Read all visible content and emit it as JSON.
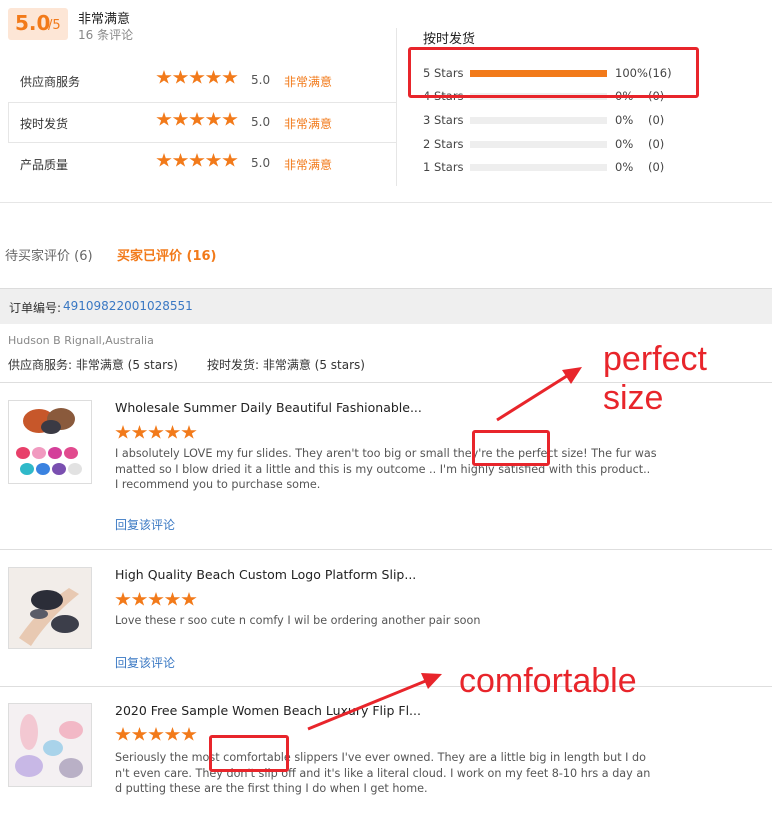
{
  "summary": {
    "score": "5.0",
    "score_max": "/5",
    "rating_label": "非常满意",
    "review_count": "16 条评论"
  },
  "dimensions": [
    {
      "label": "供应商服务",
      "value": "5.0",
      "grade": "非常满意",
      "stars": 5
    },
    {
      "label": "按时发货",
      "value": "5.0",
      "grade": "非常满意",
      "stars": 5
    },
    {
      "label": "产品质量",
      "value": "5.0",
      "grade": "非常满意",
      "stars": 5
    }
  ],
  "shipping": {
    "title": "按时发货",
    "rows": [
      {
        "label": "5 Stars",
        "pct": "100%",
        "count": "(16)",
        "fraction": 1.0
      },
      {
        "label": "4 Stars",
        "pct": "0%",
        "count": "(0)",
        "fraction": 0
      },
      {
        "label": "3 Stars",
        "pct": "0%",
        "count": "(0)",
        "fraction": 0
      },
      {
        "label": "2 Stars",
        "pct": "0%",
        "count": "(0)",
        "fraction": 0
      },
      {
        "label": "1 Stars",
        "pct": "0%",
        "count": "(0)",
        "fraction": 0
      }
    ]
  },
  "tabs": {
    "pending": "待买家评价 (6)",
    "done": "买家已评价 (16)"
  },
  "order": {
    "label": "订单编号:",
    "number": "4910982200102855 1"
  },
  "buyer": {
    "name": "Hudson B Rignall,Australia",
    "supplier_service": "供应商服务: 非常满意  (5 stars)",
    "on_time": "按时发货: 非常满意  (5 stars)"
  },
  "reviews": [
    {
      "title": "Wholesale Summer Daily Beautiful Fashionable...",
      "stars": 5,
      "text": "I absolutely LOVE my fur slides. They aren't too big or small they're the perfect size! The fur was matted so I blow dried it a little and this is my outcome .. I'm highly satisfied with this product.. I recommend you to purchase some.",
      "reply": "回复该评论"
    },
    {
      "title": "High Quality Beach Custom Logo Platform Slip...",
      "stars": 5,
      "text": "Love these r soo cute n comfy I wil be ordering another pair soon",
      "reply": "回复该评论"
    },
    {
      "title": "2020 Free Sample Women Beach Luxury Flip Fl...",
      "stars": 5,
      "text": "Seriously the most comfortable slippers I've ever owned. They are a little big in length but I don't even care. They don't slip off and it's like a literal cloud. I work on my feet 8-10 hrs a day and putting these are the first thing I do when I get home."
    }
  ],
  "annotations": {
    "perfect_size": "perfect\nsize",
    "comfortable": "comfortable",
    "color": "#e8252b"
  },
  "colors": {
    "accent": "#f27a1a",
    "link": "#3a78c3"
  }
}
